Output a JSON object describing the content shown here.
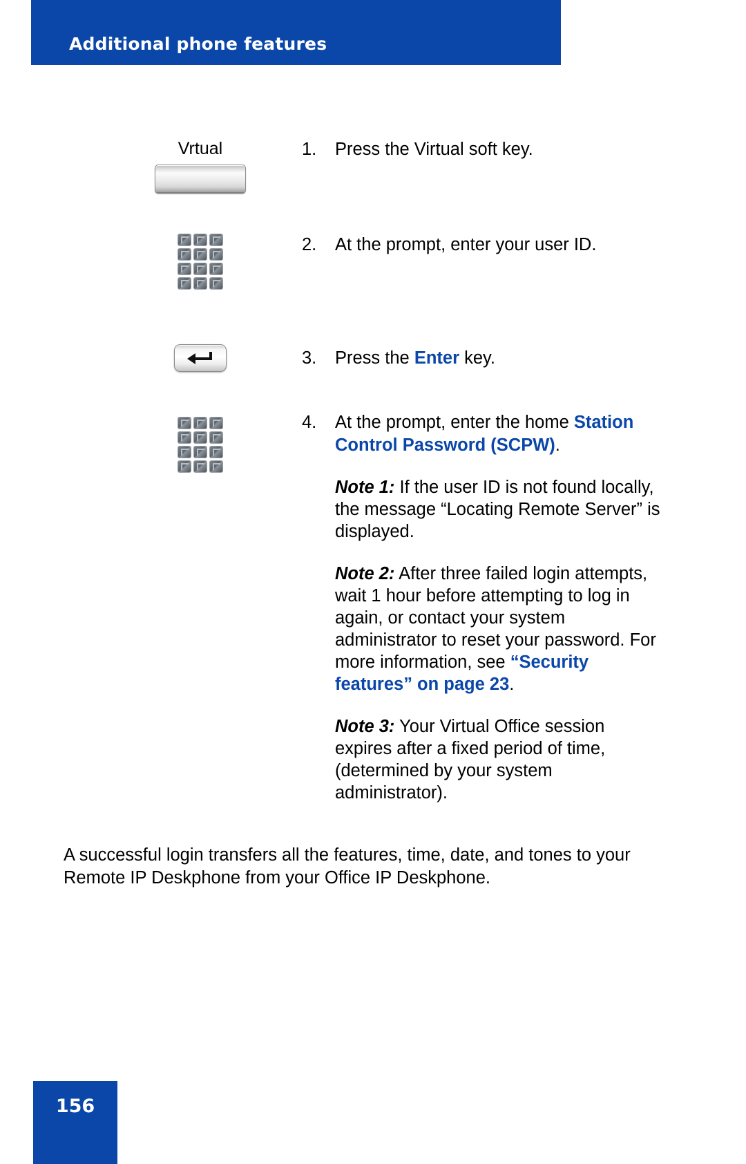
{
  "page": {
    "header_title": "Additional phone features",
    "page_number": "156",
    "accent_color": "#0A47A9",
    "text_color": "#000000"
  },
  "steps": [
    {
      "number": "1.",
      "icon": "softkey-button",
      "softkey_label": "Vrtual",
      "text_prefix": "Press the Virtual soft key.",
      "text_accent": "",
      "text_suffix": ""
    },
    {
      "number": "2.",
      "icon": "dialpad-keypad",
      "softkey_label": "",
      "text_prefix": "At the prompt, enter your user ID.",
      "text_accent": "",
      "text_suffix": ""
    },
    {
      "number": "3.",
      "icon": "enter-key",
      "softkey_label": "",
      "text_prefix": "Press the ",
      "text_accent": "Enter",
      "text_suffix": " key."
    },
    {
      "number": "4.",
      "icon": "dialpad-keypad",
      "softkey_label": "",
      "text_prefix": "At the prompt, enter the home ",
      "text_accent": "Station Control Password (SCPW)",
      "text_suffix": "."
    }
  ],
  "notes": [
    {
      "label": "Note 1:",
      "body": " If the user ID is not found locally, the message “Locating Remote Server” is displayed.",
      "body_after_link": "",
      "link_text": "",
      "link_tail": ""
    },
    {
      "label": "Note 2:",
      "body": " After three failed login attempts, wait 1 hour before attempting to log in again, or contact your system administrator to reset your password. For more information, see ",
      "link_text": "“Security features” on page 23",
      "link_tail": ".",
      "body_after_link": ""
    },
    {
      "label": "Note 3:",
      "body": " Your Virtual Office session expires after a fixed period of time, (determined by your system administrator).",
      "link_text": "",
      "link_tail": "",
      "body_after_link": ""
    }
  ],
  "summary": {
    "text": "A successful login transfers all the features, time, date, and tones to your Remote IP Deskphone from your Office IP Deskphone."
  },
  "icons": {
    "softkey": "softkey-button-icon",
    "keypad": "dialpad-keypad-icon",
    "enter": "enter-key-icon"
  }
}
